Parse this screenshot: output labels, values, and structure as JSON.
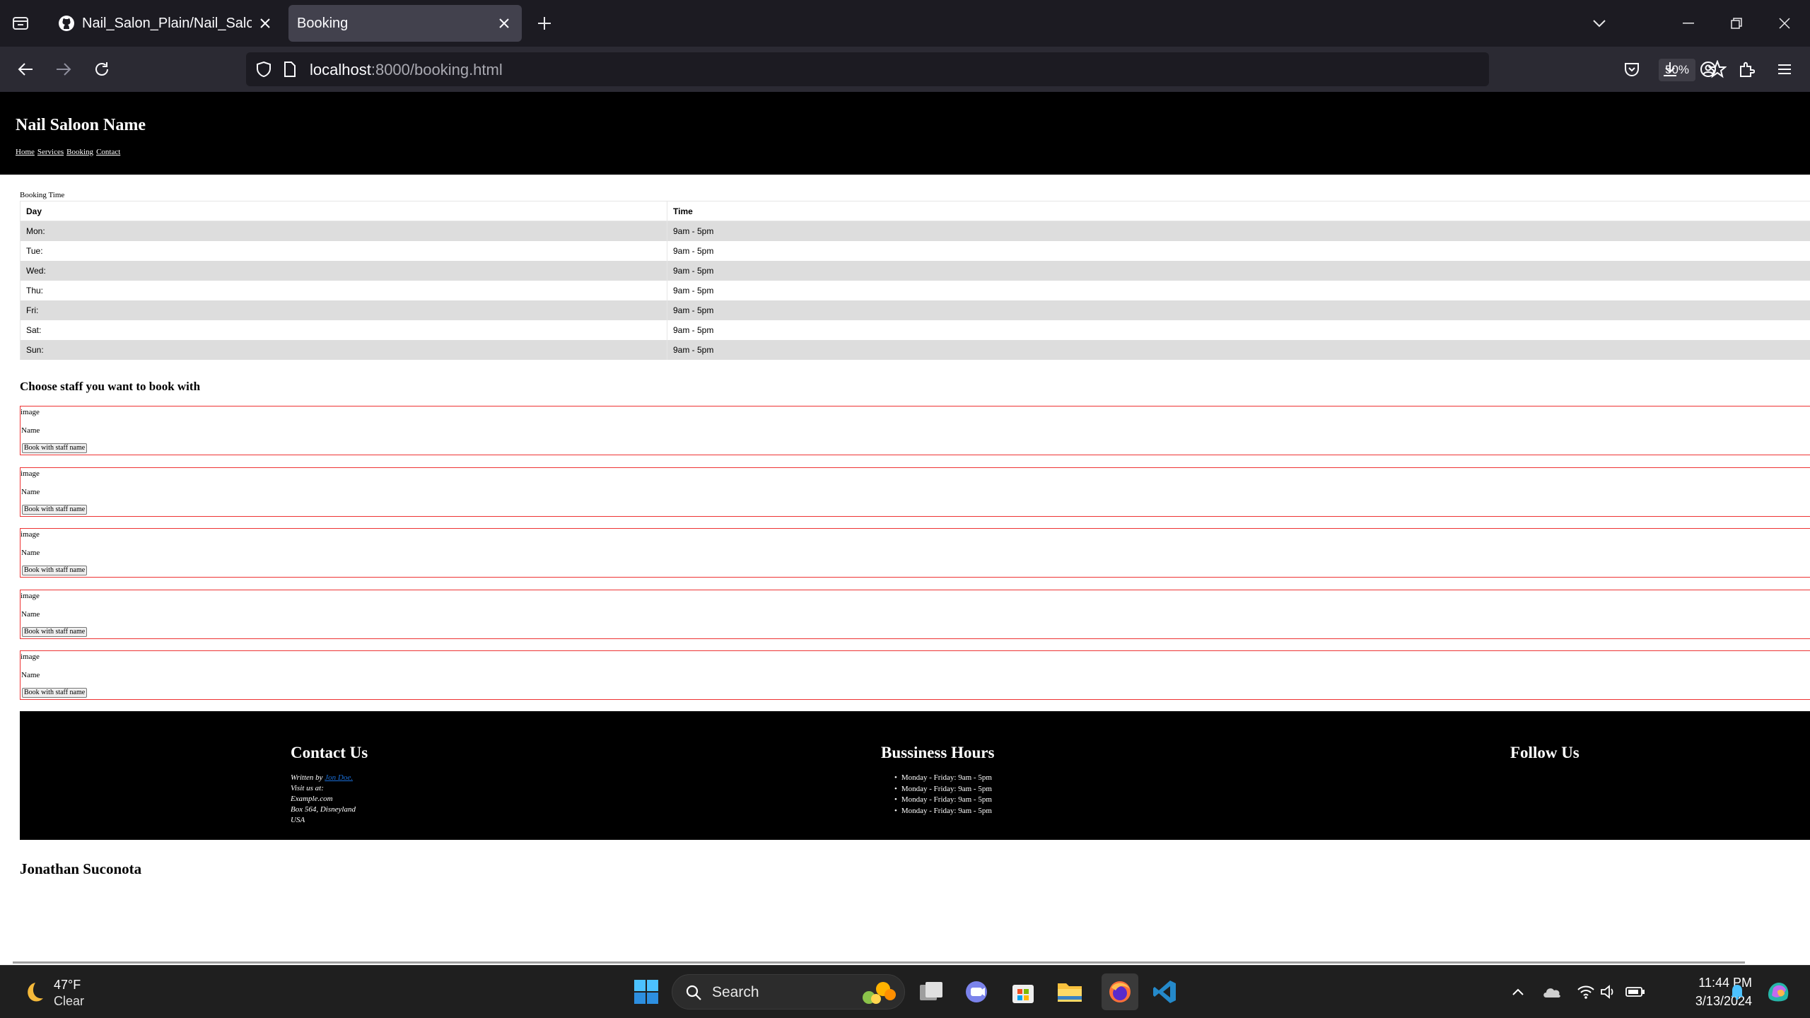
{
  "browser": {
    "tabs": [
      {
        "title": "Nail_Salon_Plain/Nail_Salon_We",
        "active": false
      },
      {
        "title": "Booking",
        "active": true
      }
    ],
    "url_host": "localhost",
    "url_path": ":8000/booking.html",
    "zoom": "50%"
  },
  "site": {
    "name": "Nail Saloon Name",
    "nav": [
      "Home",
      "Services",
      "Booking",
      "Contact"
    ],
    "table_caption": "Booking Time",
    "table_headers": [
      "Day",
      "Time"
    ],
    "table_rows": [
      {
        "day": "Mon:",
        "time": "9am - 5pm"
      },
      {
        "day": "Tue:",
        "time": "9am - 5pm"
      },
      {
        "day": "Wed:",
        "time": "9am - 5pm"
      },
      {
        "day": "Thu:",
        "time": "9am - 5pm"
      },
      {
        "day": "Fri:",
        "time": "9am - 5pm"
      },
      {
        "day": "Sat:",
        "time": "9am - 5pm"
      },
      {
        "day": "Sun:",
        "time": "9am - 5pm"
      }
    ],
    "staff_heading": "Choose staff you want to book with",
    "staff": [
      {
        "image": "image",
        "name": "Name",
        "button": "Book with staff name"
      },
      {
        "image": "image",
        "name": "Name",
        "button": "Book with staff name"
      },
      {
        "image": "image",
        "name": "Name",
        "button": "Book with staff name"
      },
      {
        "image": "image",
        "name": "Name",
        "button": "Book with staff name"
      },
      {
        "image": "image",
        "name": "Name",
        "button": "Book with staff name"
      }
    ],
    "footer": {
      "contact_title": "Contact Us",
      "written_by": "Written by ",
      "author_link": "Jon Doe.",
      "visit": "Visit us at:",
      "site": "Example.com",
      "box": "Box 564, Disneyland",
      "country": "USA",
      "hours_title": "Bussiness Hours",
      "hours": [
        "Monday - Friday: 9am - 5pm",
        "Monday - Friday: 9am - 5pm",
        "Monday - Friday: 9am - 5pm",
        "Monday - Friday: 9am - 5pm"
      ],
      "follow_title": "Follow Us"
    },
    "author": "Jonathan Suconota"
  },
  "taskbar": {
    "weather_temp": "47°F",
    "weather_desc": "Clear",
    "search_label": "Search",
    "time": "11:44 PM",
    "date": "3/13/2024"
  },
  "colors": {
    "chrome_dark": "#1c1b22",
    "chrome_toolbar": "#2b2a33",
    "staff_border": "#ee3333",
    "row_stripe": "#dddddd"
  }
}
